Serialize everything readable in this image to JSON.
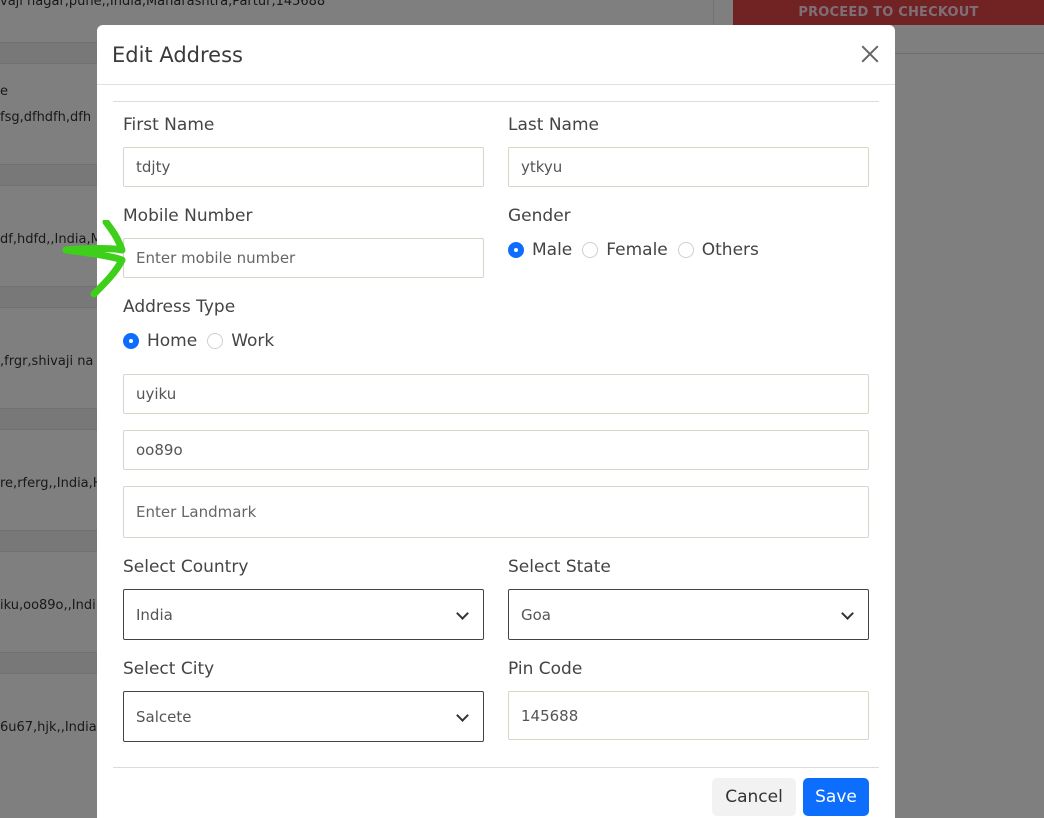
{
  "background": {
    "address_snippets": [
      "vaji nagar,pune,,India,Maharashtra,Partur,145688",
      "e",
      "fsg,dfhdfh,dfh",
      "df,hdfd,,India,M",
      ",frgr,shivaji na",
      "re,rferg,,India,H",
      "iku,oo89o,,Indi",
      "6u67,hjk,,India"
    ],
    "checkout_label": "PROCEED TO CHECKOUT"
  },
  "modal": {
    "title": "Edit Address",
    "first_name": {
      "label": "First Name",
      "value": "tdjty"
    },
    "last_name": {
      "label": "Last Name",
      "value": "ytkyu"
    },
    "mobile": {
      "label": "Mobile Number",
      "placeholder": "Enter mobile number",
      "value": ""
    },
    "gender": {
      "label": "Gender",
      "options": [
        "Male",
        "Female",
        "Others"
      ],
      "selected": "Male"
    },
    "address_type": {
      "label": "Address Type",
      "options": [
        "Home",
        "Work"
      ],
      "selected": "Home"
    },
    "address_line1": {
      "value": "uyiku"
    },
    "address_line2": {
      "value": "oo89o"
    },
    "landmark": {
      "placeholder": "Enter Landmark",
      "value": ""
    },
    "country": {
      "label": "Select Country",
      "value": "India"
    },
    "state": {
      "label": "Select State",
      "value": "Goa"
    },
    "city": {
      "label": "Select City",
      "value": "Salcete"
    },
    "pincode": {
      "label": "Pin Code",
      "value": "145688"
    },
    "cancel_label": "Cancel",
    "save_label": "Save"
  },
  "colors": {
    "primary": "#0d6efd",
    "checkout": "#e24444",
    "annotation_arrow": "#3ecf1a"
  }
}
